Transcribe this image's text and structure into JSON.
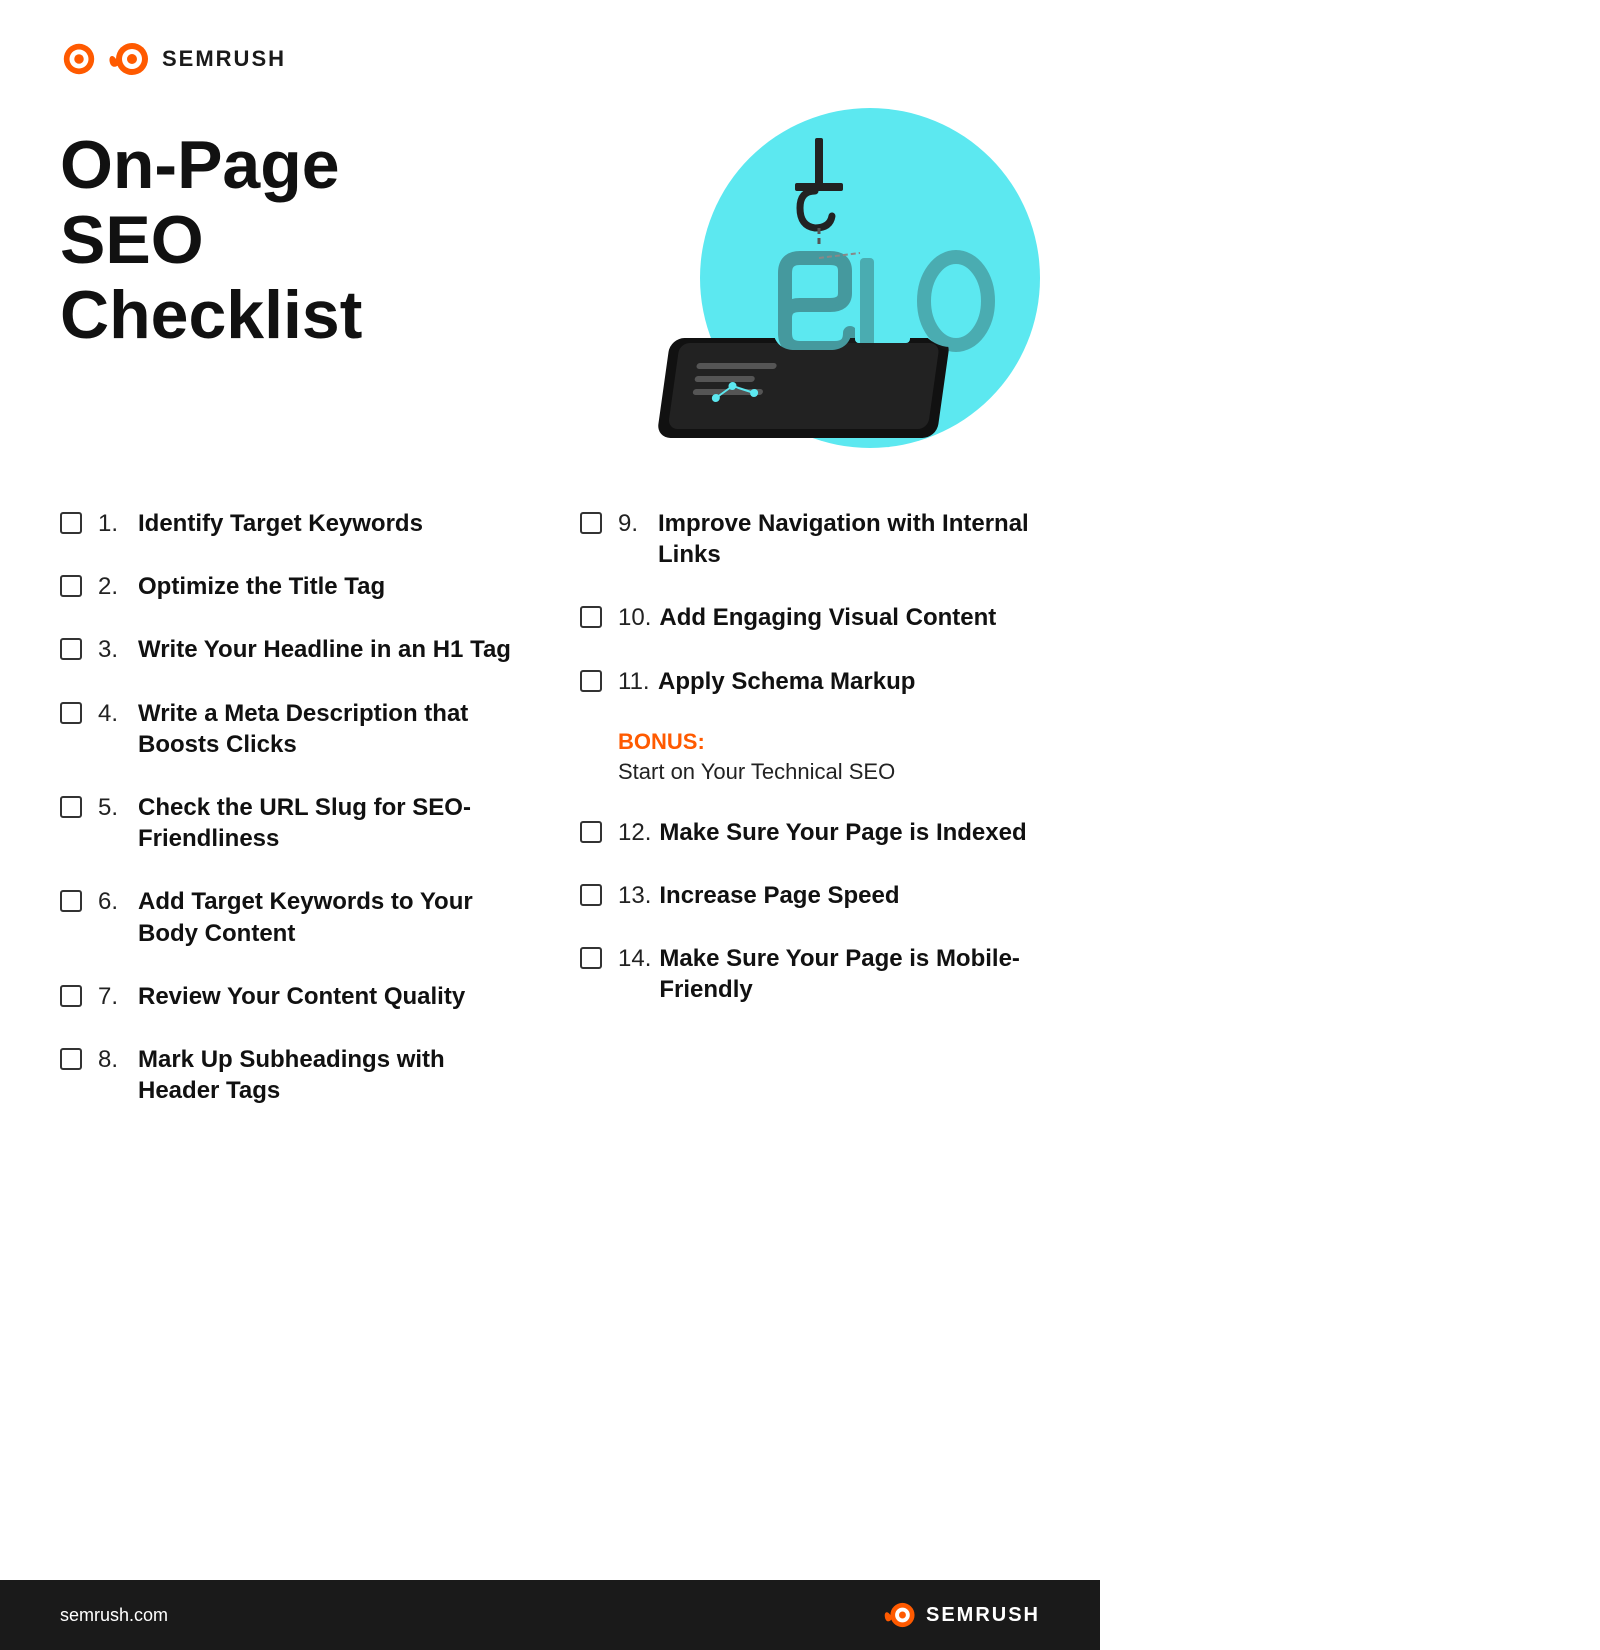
{
  "brand": {
    "name": "SEMRUSH",
    "url": "semrush.com"
  },
  "page": {
    "title_line1": "On-Page SEO",
    "title_line2": "Checklist"
  },
  "checklist_left": [
    {
      "number": "1.",
      "text": "Identify Target Keywords"
    },
    {
      "number": "2.",
      "text": "Optimize the Title Tag"
    },
    {
      "number": "3.",
      "text": "Write Your Headline in an H1 Tag"
    },
    {
      "number": "4.",
      "text": "Write a Meta Description that Boosts Clicks"
    },
    {
      "number": "5.",
      "text": "Check the URL Slug for SEO-Friendliness"
    },
    {
      "number": "6.",
      "text": "Add Target Keywords to Your Body Content"
    },
    {
      "number": "7.",
      "text": "Review Your Content Quality"
    },
    {
      "number": "8.",
      "text": "Mark Up Subheadings with Header Tags"
    }
  ],
  "checklist_right": [
    {
      "number": "9.",
      "text": "Improve Navigation with Internal Links"
    },
    {
      "number": "10.",
      "text": "Add Engaging Visual Content"
    },
    {
      "number": "11.",
      "text": "Apply Schema Markup"
    }
  ],
  "bonus": {
    "label": "BONUS:",
    "text": "Start on Your Technical SEO"
  },
  "checklist_right_2": [
    {
      "number": "12.",
      "text": "Make Sure Your Page is Indexed"
    },
    {
      "number": "13.",
      "text": "Increase Page Speed"
    },
    {
      "number": "14.",
      "text": "Make Sure Your Page is Mobile-Friendly"
    }
  ]
}
